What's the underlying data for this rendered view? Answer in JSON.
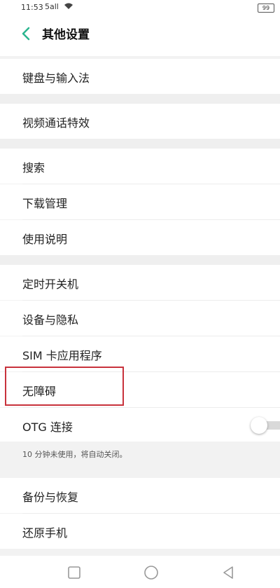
{
  "status_bar": {
    "time": "11:53",
    "signal_text": "5all",
    "battery": "99"
  },
  "header": {
    "title": "其他设置"
  },
  "items": {
    "keyboard": "键盘与输入法",
    "video_effects": "视频通话特效",
    "search": "搜索",
    "download": "下载管理",
    "manual": "使用说明",
    "schedule_power": "定时开关机",
    "device_privacy": "设备与隐私",
    "sim_apps": "SIM 卡应用程序",
    "accessibility": "无障碍",
    "otg": "OTG 连接",
    "backup": "备份与恢复",
    "reset": "还原手机"
  },
  "otg_note": "10 分钟未使用，将自动关闭。",
  "otg_enabled": false,
  "accent_color": "#2bb58f",
  "highlight_color": "#c8323c"
}
